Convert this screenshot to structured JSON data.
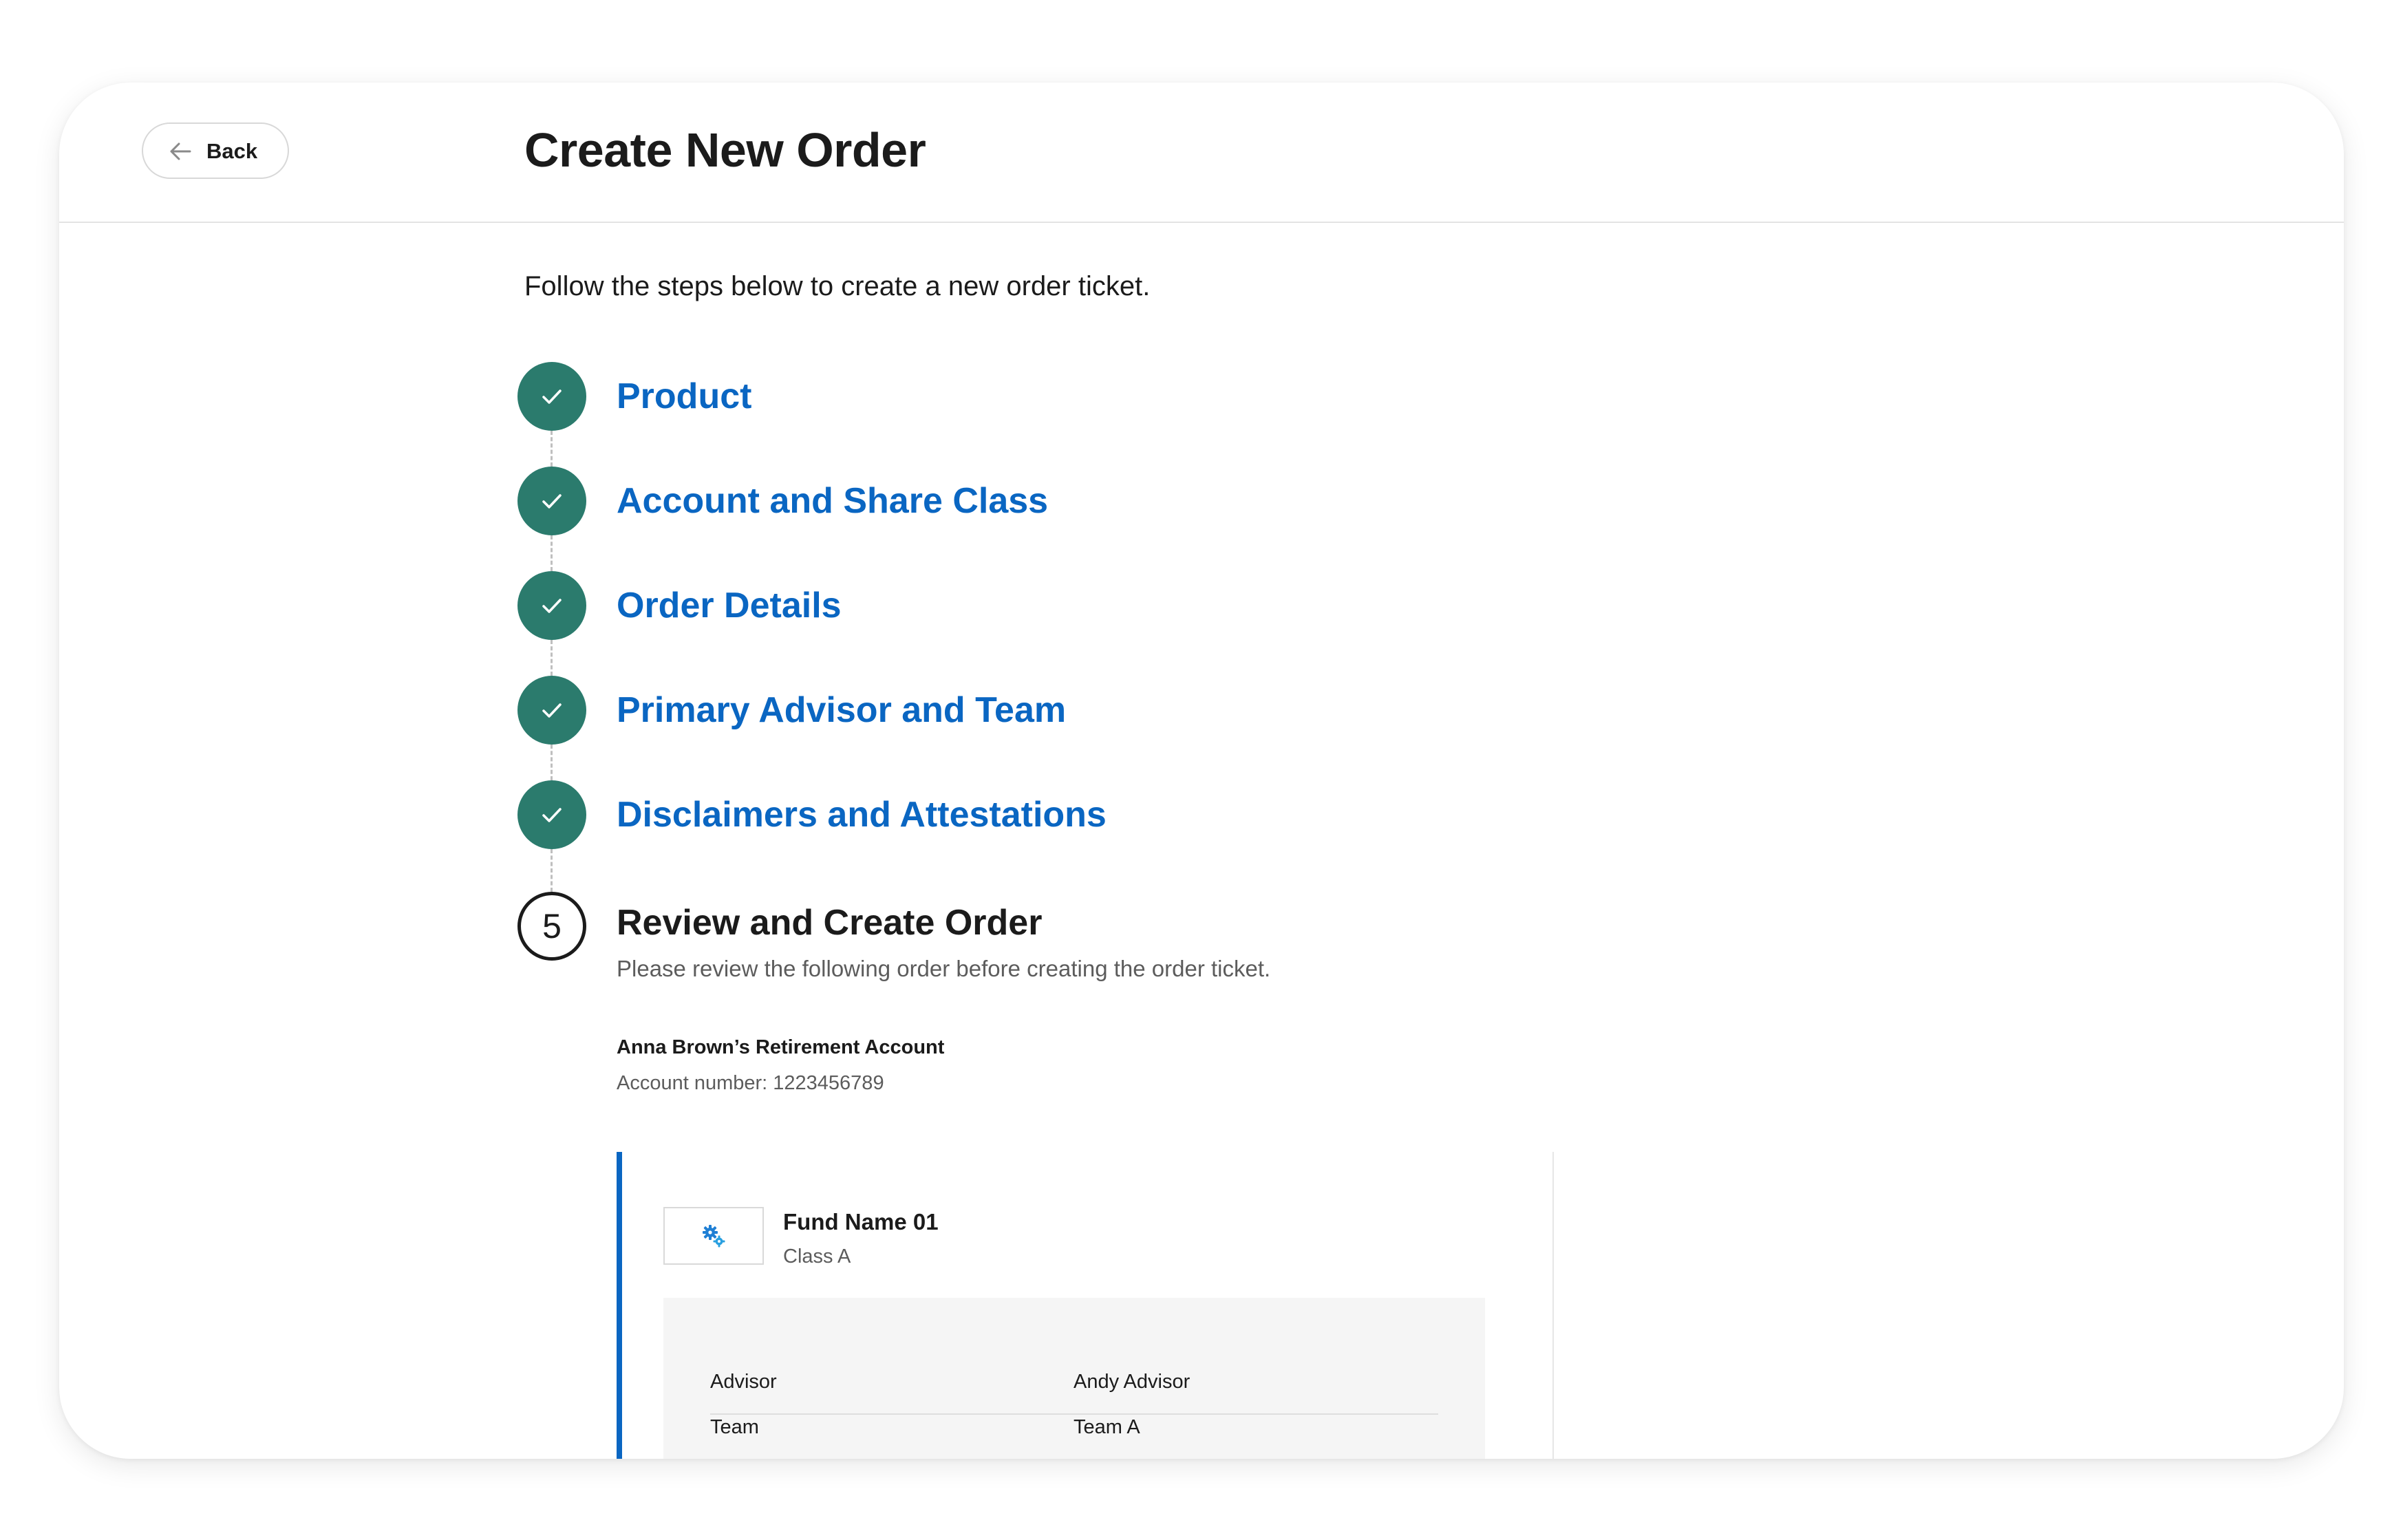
{
  "header": {
    "back_label": "Back",
    "title": "Create New Order"
  },
  "intro": "Follow the steps below to create a new order ticket.",
  "steps": [
    {
      "label": "Product",
      "status": "complete"
    },
    {
      "label": "Account and Share Class",
      "status": "complete"
    },
    {
      "label": "Order Details",
      "status": "complete"
    },
    {
      "label": "Primary Advisor and Team",
      "status": "complete"
    },
    {
      "label": "Disclaimers and Attestations",
      "status": "complete"
    }
  ],
  "current_step": {
    "number": "5",
    "title": "Review and Create Order",
    "description": "Please review the following order before creating the order ticket."
  },
  "account": {
    "name": "Anna Brown’s Retirement Account",
    "number": "Account number: 1223456789"
  },
  "fund": {
    "name": "Fund Name 01",
    "class": "Class A",
    "icon": "gears-icon",
    "details": [
      {
        "label": "Advisor",
        "value": "Andy Advisor"
      },
      {
        "label": "Team",
        "value": "Team A"
      }
    ]
  },
  "colors": {
    "accent": "#0a66c2",
    "complete": "#2b7b6d",
    "text": "#1b1b1b",
    "muted": "#5c5c5c"
  }
}
